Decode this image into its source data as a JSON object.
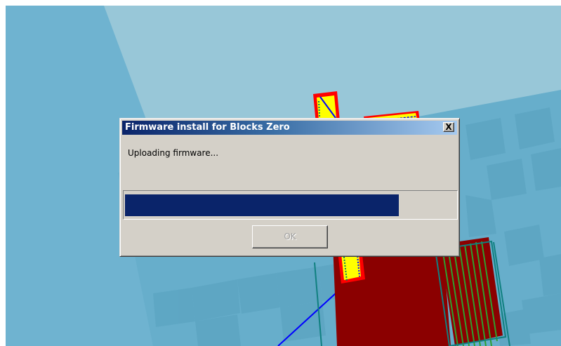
{
  "dialog": {
    "title": "Firmware install for Blocks Zero",
    "close_icon": "close-icon",
    "close_glyph": "X",
    "message": "Uploading firmware...",
    "ok_label": "OK",
    "ok_enabled": false,
    "progress": 0.83
  },
  "colors": {
    "scene_background": "#98c7d8",
    "floor_light": "#6eb2cf",
    "floor_dark": "#5ea6c3",
    "titlebar_start": "#0a246a",
    "titlebar_end": "#a6caf0",
    "progress_fill": "#0a246a",
    "part_red": "#8b0000",
    "part_yellow": "#ffff00",
    "toolpath_blue": "#0000ff",
    "outline_teal": "#108080"
  }
}
